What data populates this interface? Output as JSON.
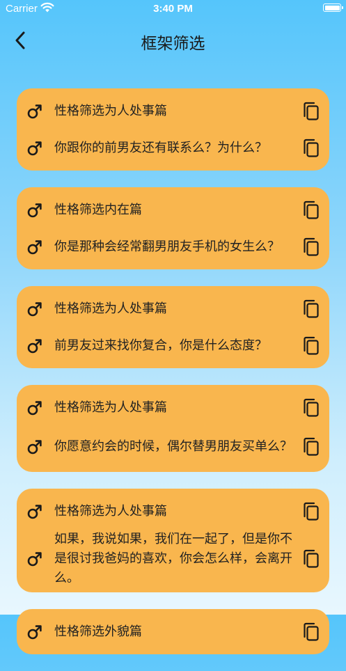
{
  "status_bar": {
    "carrier": "Carrier",
    "time": "3:40 PM"
  },
  "nav": {
    "title": "框架筛选"
  },
  "cards": [
    {
      "rows": [
        {
          "text": "性格筛选为人处事篇"
        },
        {
          "text": "你跟你的前男友还有联系么？为什么？"
        }
      ]
    },
    {
      "rows": [
        {
          "text": "性格筛选内在篇"
        },
        {
          "text": "你是那种会经常翻男朋友手机的女生么？"
        }
      ]
    },
    {
      "rows": [
        {
          "text": "性格筛选为人处事篇"
        },
        {
          "text": "前男友过来找你复合，你是什么态度？"
        }
      ]
    },
    {
      "rows": [
        {
          "text": "性格筛选为人处事篇"
        },
        {
          "text": "你愿意约会的时候，偶尔替男朋友买单么？"
        }
      ]
    },
    {
      "rows": [
        {
          "text": "性格筛选为人处事篇"
        },
        {
          "text": "如果，我说如果，我们在一起了，但是你不是很讨我爸妈的喜欢，你会怎么样，会离开么。"
        }
      ]
    },
    {
      "rows": [
        {
          "text": "性格筛选外貌篇"
        }
      ]
    }
  ],
  "icons": {
    "row_icon": "male-symbol-icon",
    "action_icon": "copy-icon",
    "back_icon": "chevron-left-icon"
  },
  "colors": {
    "card": "#f9b64e",
    "background_top": "#55c5fb",
    "background_bottom": "#e8f7fe"
  }
}
